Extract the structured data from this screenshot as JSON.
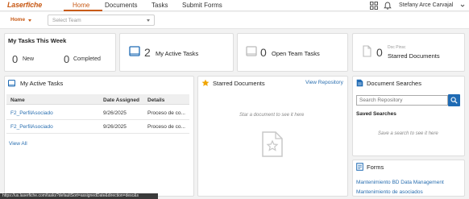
{
  "nav": {
    "logo": "Laserfiche",
    "items": [
      "Home",
      "Documents",
      "Tasks",
      "Submit Forms"
    ],
    "user": "Stefany Arce Carvajal"
  },
  "subbar": {
    "home_dropdown": "Home",
    "team_placeholder": "Select Team"
  },
  "tasks_week": {
    "title": "My Tasks This Week",
    "new_count": "0",
    "new_label": "New",
    "completed_count": "0",
    "completed_label": "Completed"
  },
  "active_tasks_stat": {
    "count": "2",
    "label": "My Active Tasks"
  },
  "team_tasks_stat": {
    "count": "0",
    "label": "Open Team Tasks"
  },
  "starred_stat": {
    "count": "0",
    "sub": "Doc Pinsc",
    "label": "Starred Documents"
  },
  "active_tasks": {
    "title": "My Active Tasks",
    "columns": [
      "Name",
      "Date Assigned",
      "Details"
    ],
    "rows": [
      [
        "F2_PerfilAsociado",
        "9/26/2025",
        "Proceso de co..."
      ],
      [
        "F2_PerfilAsociado",
        "9/26/2025",
        "Proceso de co..."
      ]
    ],
    "view_all": "View All"
  },
  "starred_docs": {
    "title": "Starred Documents",
    "link": "View Repository",
    "empty": "Star a document to see it here"
  },
  "doc_searches": {
    "title": "Document Searches",
    "placeholder": "Search Repository",
    "saved_title": "Saved Searches",
    "empty": "Save a search to see it here"
  },
  "forms": {
    "title": "Forms",
    "items": [
      "Mantenimiento BD Data Management",
      "Mantenimiento de asociados"
    ]
  },
  "status_url": "https://us.laserfiche.com/tasks?defaultSort=assignedDate&direction=desc&s"
}
